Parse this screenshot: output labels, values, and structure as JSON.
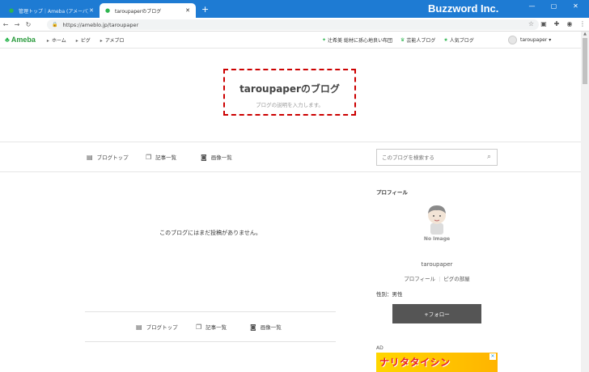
{
  "browser": {
    "tabs": [
      {
        "title": "管理トップ｜Ameba (アメーバ)",
        "active": false
      },
      {
        "title": "taroupaperのブログ",
        "active": true
      }
    ],
    "new_tab": "+",
    "brand_overlay": "Buzzword Inc.",
    "url": "https://ameblo.jp/taroupaper",
    "window_controls": [
      "—",
      "▢",
      "✕"
    ]
  },
  "ameba_header": {
    "logo": "Ameba",
    "nav": [
      "ホーム",
      "ピグ",
      "アメブロ"
    ],
    "links": [
      {
        "label": "辻希美 総材に孫心地良い布団",
        "icon": "sparkle-icon"
      },
      {
        "label": "芸能人ブログ",
        "icon": "crown-icon"
      },
      {
        "label": "人気ブログ",
        "icon": "star-icon"
      }
    ],
    "user": "taroupaper ▾"
  },
  "blog": {
    "title": "taroupaperのブログ",
    "description": "ブログの説明を入力します。"
  },
  "menu": {
    "items": [
      "ブログトップ",
      "記事一覧",
      "画像一覧"
    ],
    "search_placeholder": "このブログを検索する"
  },
  "main": {
    "empty_message": "このブログにはまだ投稿がありません。"
  },
  "sidebar": {
    "profile_heading": "プロフィール",
    "no_image": "No Image",
    "profile_name": "taroupaper",
    "profile_link": "プロフィール",
    "pig_link": "ピグの部屋",
    "gender": "性別：男性",
    "follow_label": "+フォロー",
    "ad_label": "AD",
    "ad_text": "ナリタタイシン"
  },
  "colors": {
    "titlebar": "#1e7bd3",
    "ameba_green": "#2db54f",
    "dashed_highlight": "#cc0000",
    "follow_button": "#555555"
  }
}
